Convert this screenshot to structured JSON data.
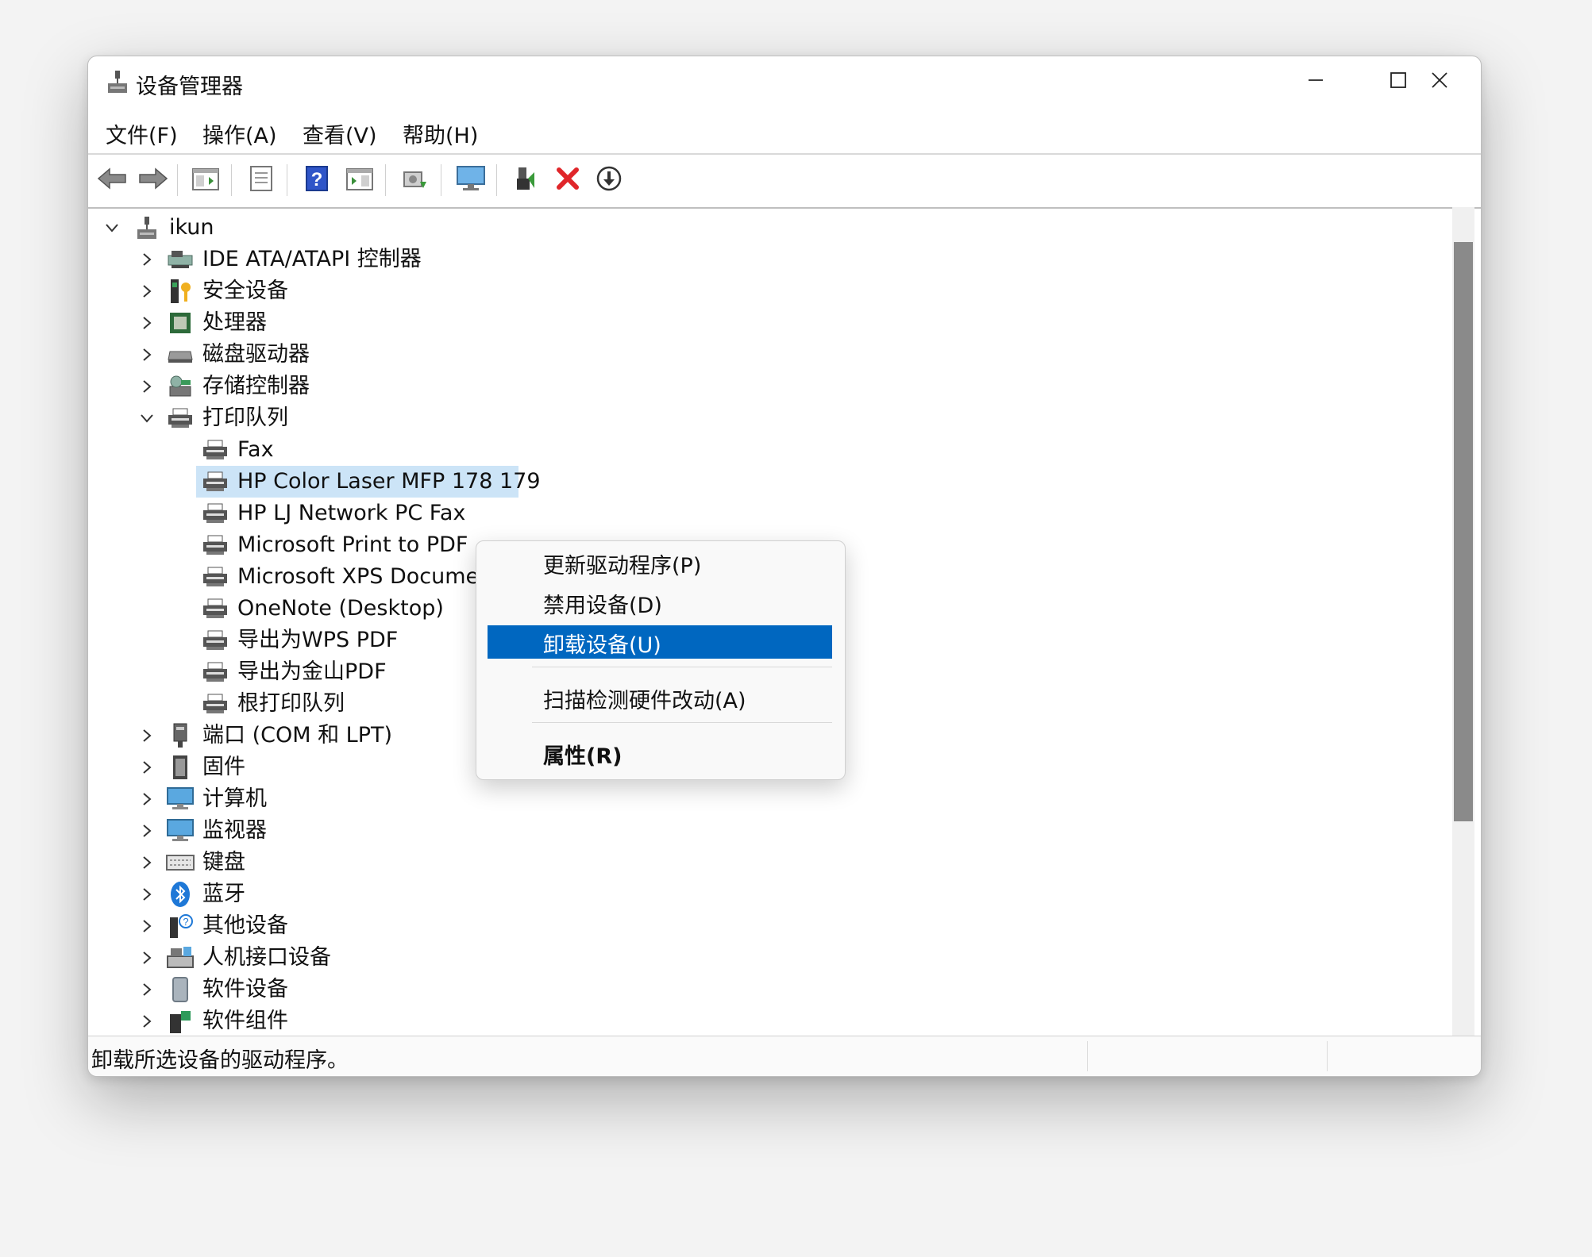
{
  "window": {
    "title": "设备管理器",
    "controls": [
      "minimize-icon",
      "maximize-icon",
      "close-icon"
    ]
  },
  "menu": [
    "文件(F)",
    "操作(A)",
    "查看(V)",
    "帮助(H)"
  ],
  "toolbar": [
    "back-icon",
    "forward-icon",
    "show-hide-tree-icon",
    "properties-icon",
    "help-icon",
    "show-hide-action-pane-icon",
    "update-driver-icon",
    "scan-hardware-icon",
    "enable-device-icon",
    "uninstall-icon",
    "download-driver-icon"
  ],
  "tree": {
    "root": "ikun",
    "categories": [
      {
        "label": "IDE ATA/ATAPI 控制器",
        "icon": "ide-controller-icon"
      },
      {
        "label": "安全设备",
        "icon": "security-device-icon"
      },
      {
        "label": "处理器",
        "icon": "processor-icon"
      },
      {
        "label": "磁盘驱动器",
        "icon": "disk-drive-icon"
      },
      {
        "label": "存储控制器",
        "icon": "storage-controller-icon"
      },
      {
        "label": "打印队列",
        "icon": "printer-icon",
        "expanded": true
      },
      {
        "label": "端口 (COM 和 LPT)",
        "icon": "port-icon"
      },
      {
        "label": "固件",
        "icon": "firmware-icon"
      },
      {
        "label": "计算机",
        "icon": "computer-icon"
      },
      {
        "label": "监视器",
        "icon": "monitor-icon"
      },
      {
        "label": "键盘",
        "icon": "keyboard-icon"
      },
      {
        "label": "蓝牙",
        "icon": "bluetooth-icon"
      },
      {
        "label": "其他设备",
        "icon": "other-device-icon"
      },
      {
        "label": "人机接口设备",
        "icon": "hid-icon"
      },
      {
        "label": "软件设备",
        "icon": "software-device-icon"
      },
      {
        "label": "软件组件",
        "icon": "software-component-icon"
      }
    ],
    "printers": [
      "Fax",
      "HP Color Laser MFP 178 179",
      "HP LJ Network PC Fax",
      "Microsoft Print to PDF",
      "Microsoft XPS Document Writer",
      "OneNote (Desktop)",
      "导出为WPS PDF",
      "导出为金山PDF",
      "根打印队列"
    ]
  },
  "context_menu": {
    "items": [
      "更新驱动程序(P)",
      "禁用设备(D)",
      "卸载设备(U)",
      "扫描检测硬件改动(A)",
      "属性(R)"
    ]
  },
  "status": {
    "text": "卸载所选设备的驱动程序。"
  },
  "colors": {
    "selection": "#cce4f7",
    "menu_active": "#0067c0",
    "close_red": "#e81123"
  }
}
